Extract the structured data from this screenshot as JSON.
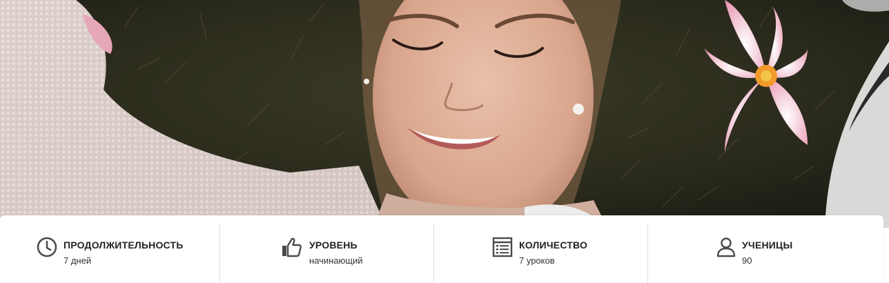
{
  "hero": {
    "image_description_icon": "portrait-photo"
  },
  "info": {
    "duration": {
      "icon": "clock-icon",
      "title": "ПРОДОЛЖИТЕЛЬНОСТЬ",
      "value": "7 дней"
    },
    "level": {
      "icon": "thumbs-up-icon",
      "title": "УРОВЕНЬ",
      "value": "начинающий"
    },
    "count": {
      "icon": "list-document-icon",
      "title": "КОЛИЧЕСТВО",
      "value": "7 уроков"
    },
    "students": {
      "icon": "user-icon",
      "title": "УЧЕНИЦЫ",
      "value": "90"
    }
  },
  "colors": {
    "icon": "#4a4a4a",
    "title": "#222222",
    "separator": "#dcdcdc"
  }
}
